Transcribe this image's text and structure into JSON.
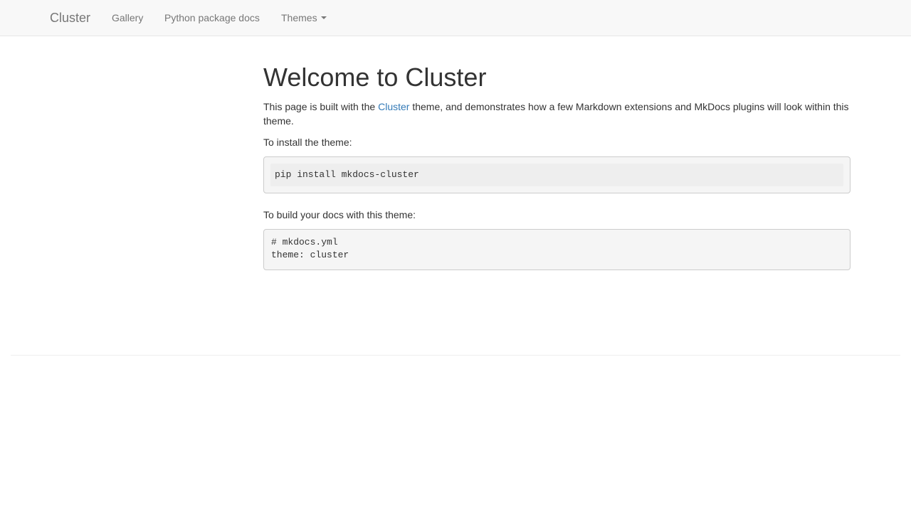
{
  "navbar": {
    "brand": "Cluster",
    "links": [
      {
        "label": "Gallery"
      },
      {
        "label": "Python package docs"
      },
      {
        "label": "Themes"
      }
    ]
  },
  "main": {
    "title": "Welcome to Cluster",
    "intro_before": "This page is built with the ",
    "intro_link": "Cluster",
    "intro_after": " theme, and demonstrates how a few Markdown extensions and MkDocs plugins will look within this theme.",
    "install_label": "To install the theme:",
    "install_code": "pip install mkdocs-cluster",
    "build_label": "To build your docs with this theme:",
    "build_code": "# mkdocs.yml\ntheme: cluster"
  },
  "colors": {
    "navbar_bg": "#f8f8f8",
    "link": "#337ab7",
    "text": "#333333",
    "nav_text": "#777777"
  }
}
